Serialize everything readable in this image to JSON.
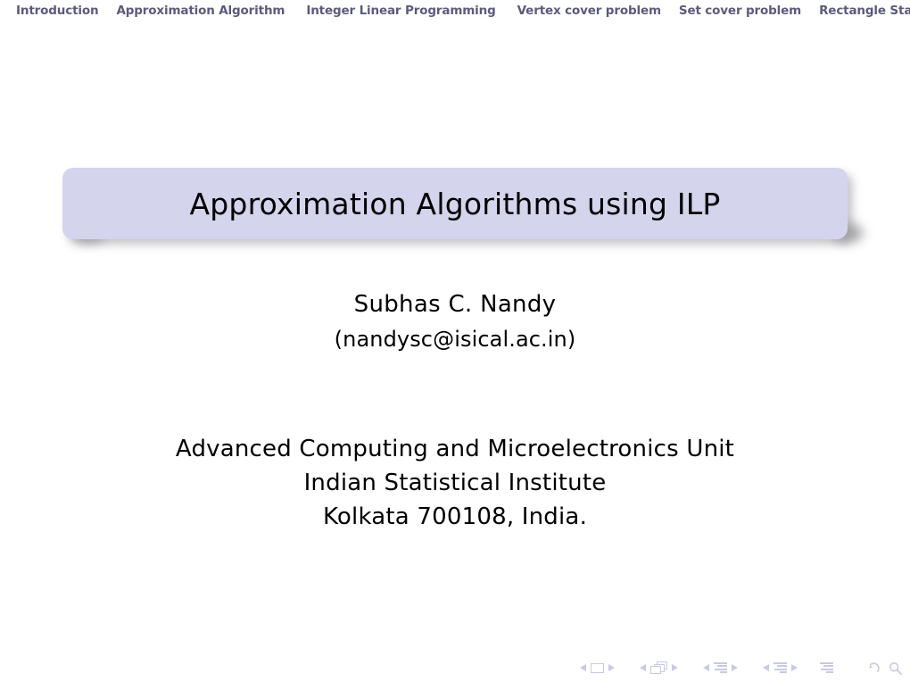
{
  "navbar": {
    "items": [
      {
        "label": "Introduction"
      },
      {
        "label": "Approximation Algorithm"
      },
      {
        "label": "Integer Linear Programming"
      },
      {
        "label": "Vertex cover problem"
      },
      {
        "label": "Set cover problem"
      },
      {
        "label": "Rectangle Sta"
      }
    ],
    "text_color": "#5b5b7c"
  },
  "title": {
    "text": "Approximation Algorithms using ILP",
    "box_color": "#d4d4ec",
    "text_color": "#000000"
  },
  "author": {
    "name": "Subhas C. Nandy",
    "email": "(nandysc@isical.ac.in)"
  },
  "institute": {
    "lines": [
      "Advanced Computing and Microelectronics Unit",
      "Indian Statistical Institute",
      "Kolkata 700108, India."
    ]
  },
  "nav_symbols": {
    "color": "#c9c9e4",
    "groups": [
      {
        "icon": "slide-icon",
        "prev": "prev-slide-arrow",
        "next": "next-slide-arrow"
      },
      {
        "icon": "frames-icon",
        "prev": "prev-frame-arrow",
        "next": "next-frame-arrow"
      },
      {
        "icon": "subsection-icon",
        "prev": "prev-subsection-arrow",
        "next": "next-subsection-arrow"
      },
      {
        "icon": "section-icon",
        "prev": "prev-section-arrow",
        "next": "next-section-arrow"
      }
    ],
    "presentation_icon": "presentation-icon",
    "back_icon": "back-arrow-icon",
    "search_icon": "search-icon",
    "forward_icon": "forward-arrow-icon"
  }
}
